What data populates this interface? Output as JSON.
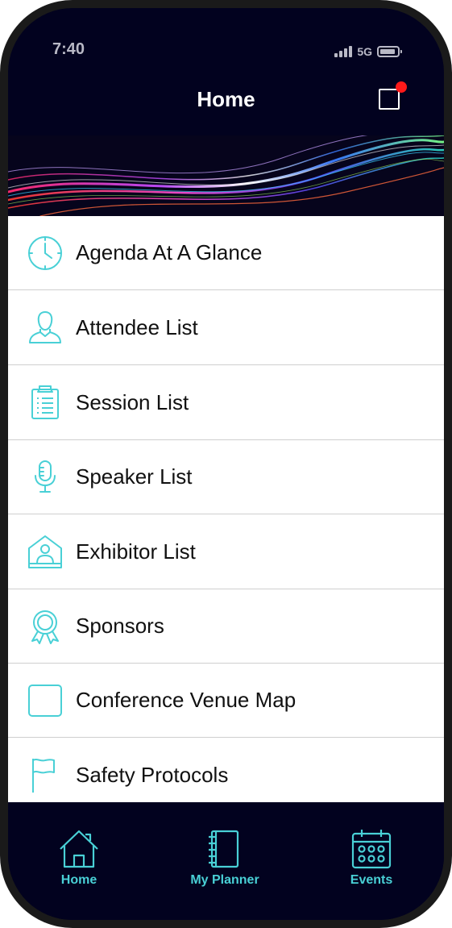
{
  "colors": {
    "accent": "#49d0d6",
    "header_bg": "#02021f",
    "notification": "#ff1a1a"
  },
  "status_bar": {
    "time": "7:40",
    "network": "5G"
  },
  "header": {
    "title": "Home"
  },
  "menu": [
    {
      "label": "Agenda At A Glance",
      "icon": "clock-icon"
    },
    {
      "label": "Attendee List",
      "icon": "person-icon"
    },
    {
      "label": "Session List",
      "icon": "clipboard-list-icon"
    },
    {
      "label": "Speaker List",
      "icon": "microphone-icon"
    },
    {
      "label": "Exhibitor List",
      "icon": "exhibitor-booth-icon"
    },
    {
      "label": "Sponsors",
      "icon": "award-ribbon-icon"
    },
    {
      "label": "Conference Venue Map",
      "icon": "square-icon"
    },
    {
      "label": "Safety Protocols",
      "icon": "flag-icon"
    }
  ],
  "tabs": [
    {
      "label": "Home",
      "icon": "home-icon"
    },
    {
      "label": "My Planner",
      "icon": "notebook-icon"
    },
    {
      "label": "Events",
      "icon": "calendar-icon"
    }
  ]
}
